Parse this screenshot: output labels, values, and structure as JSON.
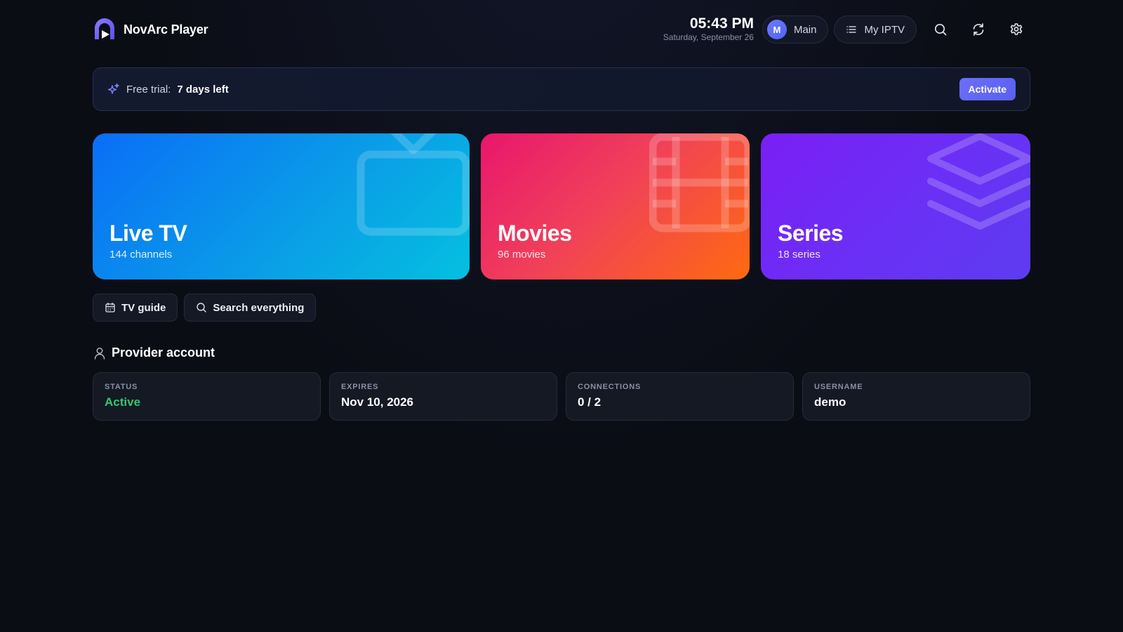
{
  "app": {
    "name": "NovArc Player",
    "logo_icon": "novarc-logo-icon"
  },
  "header": {
    "time": "05:43 PM",
    "date": "Saturday, September 26",
    "profile": {
      "initial": "M",
      "name": "Main"
    },
    "playlist": {
      "label": "My IPTV",
      "icon": "list-icon"
    },
    "icons": [
      "search-icon",
      "refresh-icon",
      "gear-icon"
    ]
  },
  "trial": {
    "prefix": "Free trial:",
    "remaining": "7 days left",
    "button": "Activate",
    "icon": "sparkles-icon"
  },
  "categories": [
    {
      "id": "live-tv",
      "title": "Live TV",
      "subtitle": "144 channels",
      "icon": "tv-icon",
      "gradient": [
        "#0a6ef7",
        "#04c0e0"
      ]
    },
    {
      "id": "movies",
      "title": "Movies",
      "subtitle": "96 movies",
      "icon": "film-icon",
      "gradient": [
        "#e8166d",
        "#ff6a10"
      ]
    },
    {
      "id": "series",
      "title": "Series",
      "subtitle": "18 series",
      "icon": "layers-icon",
      "gradient": [
        "#7b1ff5",
        "#5d3cf0"
      ]
    }
  ],
  "actions": [
    {
      "label": "TV guide",
      "icon": "calendar-icon"
    },
    {
      "label": "Search everything",
      "icon": "search-icon"
    }
  ],
  "provider": {
    "title": "Provider account",
    "icon": "user-icon",
    "stats": [
      {
        "label": "STATUS",
        "value": "Active"
      },
      {
        "label": "EXPIRES",
        "value": "Nov 10, 2026"
      },
      {
        "label": "CONNECTIONS",
        "value": "0 / 2"
      },
      {
        "label": "USERNAME",
        "value": "demo"
      }
    ]
  },
  "colors": {
    "accent": "#6b6ff8",
    "status_active": "#34c76f",
    "background": "#0b0d15"
  }
}
